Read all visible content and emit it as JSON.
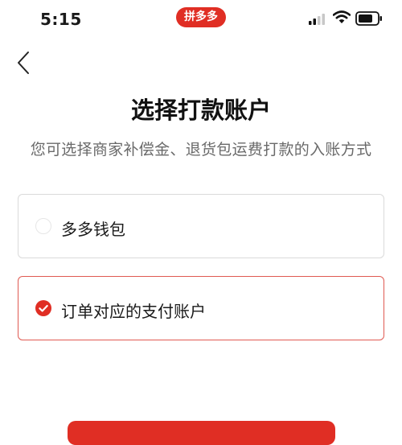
{
  "status_bar": {
    "time": "5:15",
    "app_badge": "拼多多"
  },
  "nav": {
    "back_icon": "chevron-left-icon"
  },
  "header": {
    "title": "选择打款账户",
    "subtitle": "您可选择商家补偿金、退货包运费打款的入账方式"
  },
  "options": [
    {
      "label": "多多钱包",
      "selected": false
    },
    {
      "label": "订单对应的支付账户",
      "selected": true
    }
  ],
  "colors": {
    "accent": "#e02e24",
    "selected_border": "#e05a52",
    "card_border": "#dadada",
    "subtitle_text": "#6a6a6a"
  },
  "icons": [
    "signal-icon",
    "wifi-icon",
    "battery-icon",
    "check-icon"
  ]
}
